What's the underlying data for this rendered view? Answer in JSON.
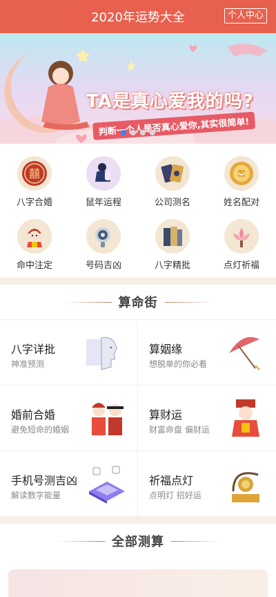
{
  "header": {
    "title": "2020年运势大全",
    "user_center": "个人中心"
  },
  "banner": {
    "headline": "TA是真心爱我的吗?",
    "subline": "判断一个人是否真心爱你,其实很简单!",
    "dots": 4,
    "active_dot": 1
  },
  "grid": [
    {
      "label": "八字合婚",
      "icon": "double-happiness-icon"
    },
    {
      "label": "鼠年运程",
      "icon": "sitting-person-icon"
    },
    {
      "label": "公司测名",
      "icon": "cards-icon"
    },
    {
      "label": "姓名配对",
      "icon": "coin-icon"
    },
    {
      "label": "命中注定",
      "icon": "doll-icon"
    },
    {
      "label": "号码吉凶",
      "icon": "phone-icon"
    },
    {
      "label": "八字精批",
      "icon": "books-icon"
    },
    {
      "label": "点灯祈福",
      "icon": "lotus-lamp-icon"
    }
  ],
  "section1": {
    "title": "算命街"
  },
  "cards": [
    {
      "title": "八字详批",
      "subtitle": "神准预测",
      "icon": "face-scan-icon"
    },
    {
      "title": "算姻缘",
      "subtitle": "想脱单的你必看",
      "icon": "umbrella-icon"
    },
    {
      "title": "婚前合婚",
      "subtitle": "避免短命的婚姻",
      "icon": "couple-icon"
    },
    {
      "title": "算财运",
      "subtitle": "财富命盘 偏财运",
      "icon": "god-of-wealth-icon"
    },
    {
      "title": "手机号测吉凶",
      "subtitle": "解读数字能量",
      "icon": "isometric-phone-icon"
    },
    {
      "title": "祈福点灯",
      "subtitle": "点明灯 招好运",
      "icon": "gong-lamp-icon"
    }
  ],
  "section2": {
    "title": "全部测算"
  },
  "colors": {
    "header": "#e8614e",
    "accent_gold": "#c9a46a",
    "divider": "#f6efe6"
  }
}
